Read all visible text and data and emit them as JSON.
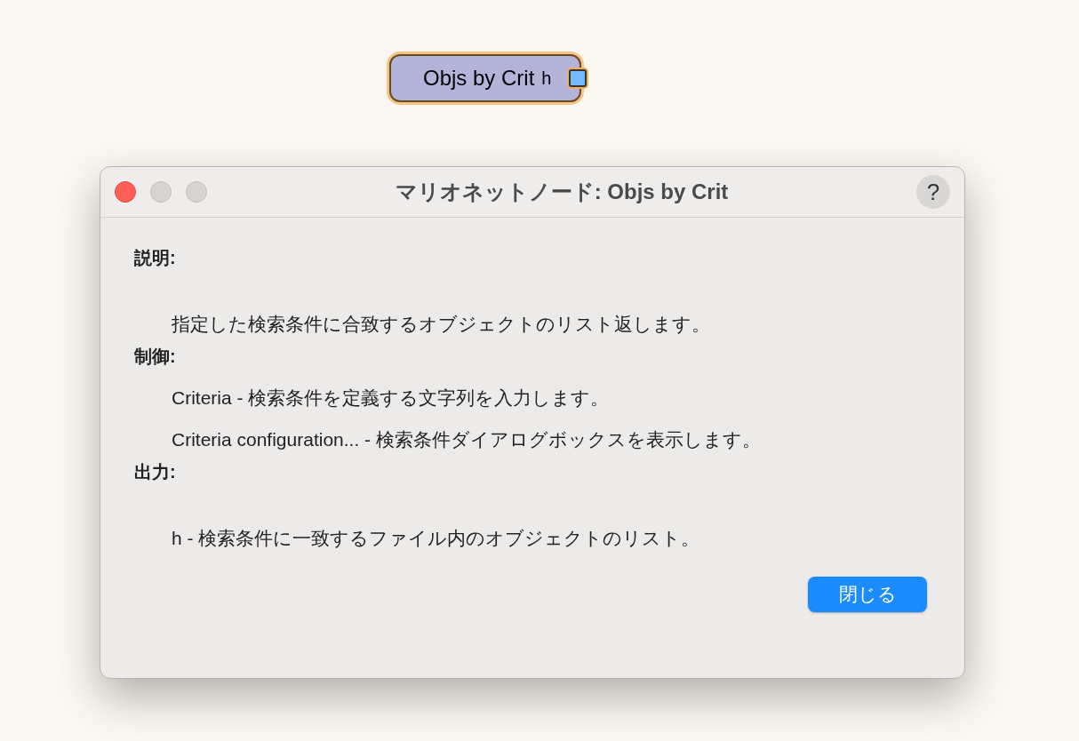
{
  "node": {
    "title": "Objs by Crit",
    "port_label": "h",
    "selected": true
  },
  "dialog": {
    "title": "マリオネットノード: Objs by Crit",
    "traffic_lights": [
      {
        "kind": "close",
        "disabled": false
      },
      {
        "kind": "minimize",
        "disabled": true
      },
      {
        "kind": "zoom",
        "disabled": true
      }
    ],
    "help_button": "?",
    "sections": [
      {
        "heading": "説明:",
        "lines": [
          "指定した検索条件に合致するオブジェクトのリスト返します。"
        ]
      },
      {
        "heading": "制御:",
        "lines": [
          "Criteria - 検索条件を定義する文字列を入力します。",
          "Criteria configuration... - 検索条件ダイアログボックスを表示します。"
        ]
      },
      {
        "heading": "出力:",
        "lines": [
          "h - 検索条件に一致するファイル内のオブジェクトのリスト。"
        ]
      }
    ],
    "close_button": "閉じる"
  }
}
